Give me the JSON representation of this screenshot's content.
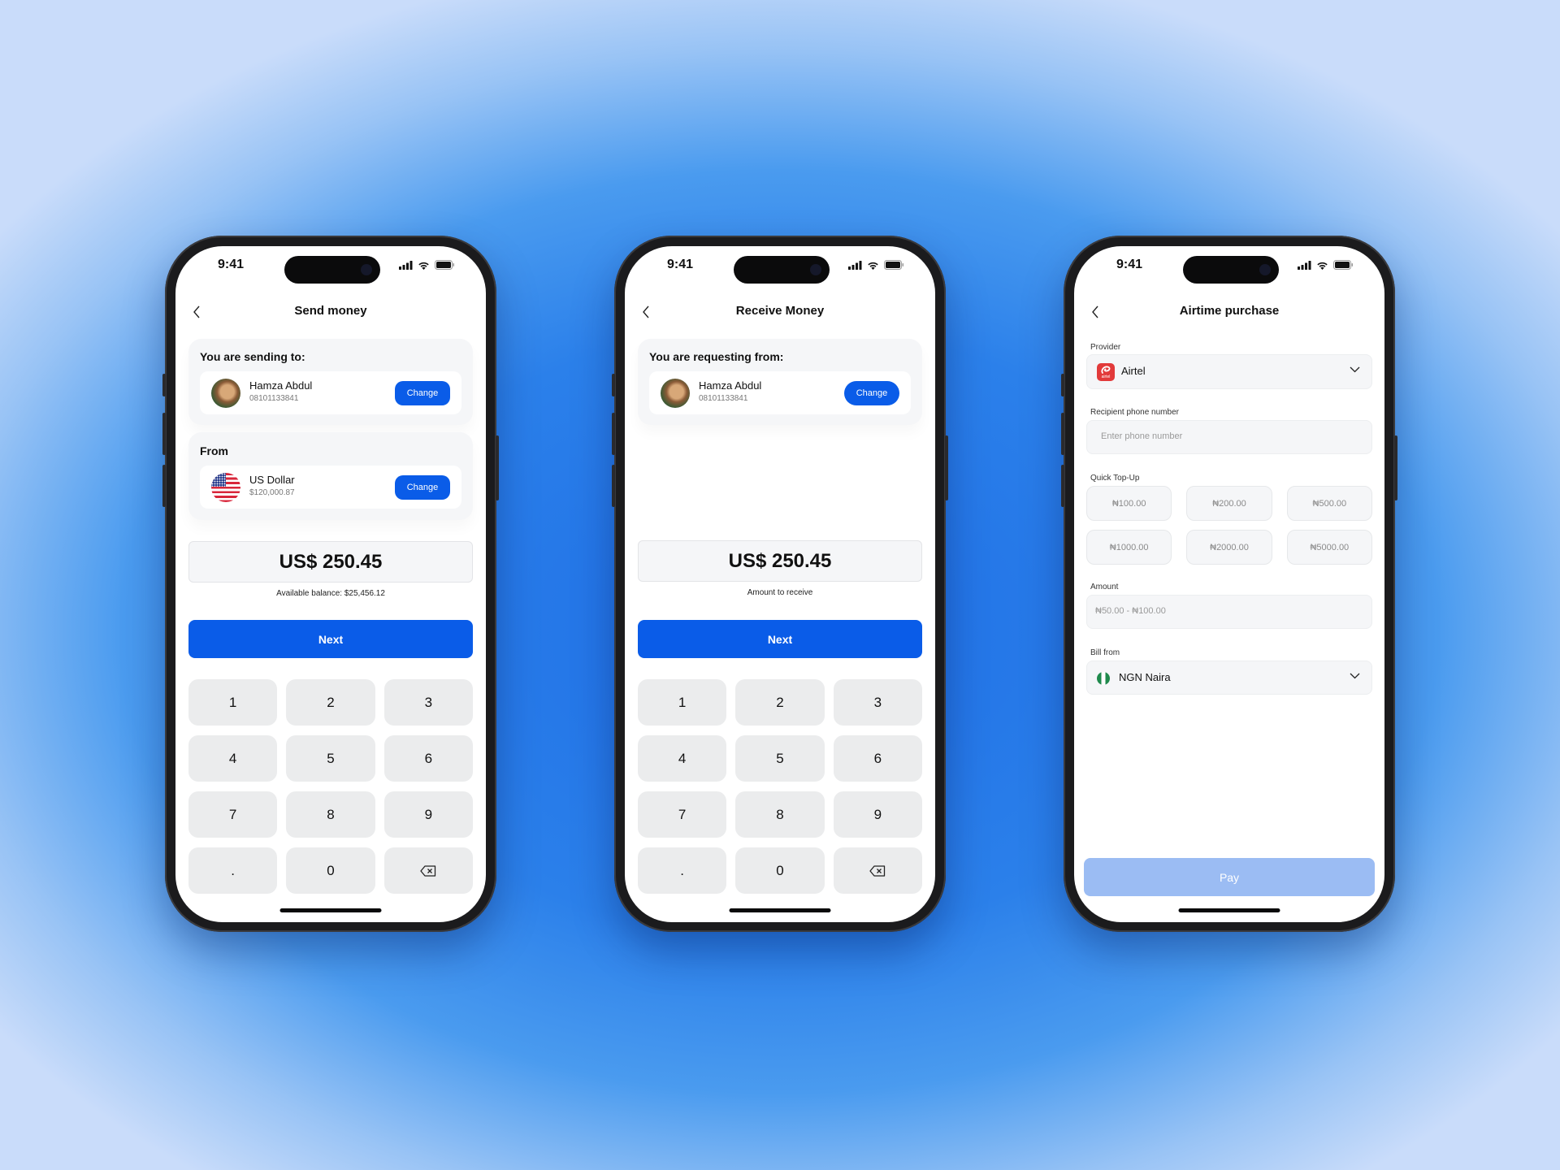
{
  "colors": {
    "primary": "#0a5ce8",
    "primary_disabled": "#9bbcf3",
    "card_bg": "#f5f6f8",
    "key_bg": "#ebeced",
    "airtel_red": "#e23a3a",
    "nigeria_green": "#1f8a4c"
  },
  "status_bar": {
    "time": "9:41",
    "icons": [
      "cellular-signal-icon",
      "wifi-icon",
      "battery-icon"
    ]
  },
  "send_money": {
    "title": "Send money",
    "recipient_section_label": "You are sending to:",
    "recipient": {
      "name": "Hamza Abdul",
      "phone": "08101133841",
      "change_label": "Change"
    },
    "from_section_label": "From",
    "source": {
      "currency": "US Dollar",
      "balance": "$120,000.87",
      "change_label": "Change"
    },
    "amount": "US$ 250.45",
    "available_balance_label": "Available balance:",
    "available_balance_value": "$25,456.12",
    "next_label": "Next"
  },
  "receive_money": {
    "title": "Receive Money",
    "requester_section_label": "You are requesting from:",
    "requester": {
      "name": "Hamza Abdul",
      "phone": "08101133841",
      "change_label": "Change"
    },
    "amount": "US$ 250.45",
    "amount_caption": "Amount to receive",
    "next_label": "Next"
  },
  "keypad": {
    "keys": [
      "1",
      "2",
      "3",
      "4",
      "5",
      "6",
      "7",
      "8",
      "9",
      ".",
      "0"
    ],
    "backspace_icon": "backspace-icon"
  },
  "airtime": {
    "title": "Airtime purchase",
    "provider_label": "Provider",
    "provider_value": "Airtel",
    "provider_logo_text": "airtel",
    "recipient_label": "Recipient phone number",
    "recipient_placeholder": "Enter phone number",
    "quick_topup_label": "Quick Top-Up",
    "quick_topup_options": [
      "₦100.00",
      "₦200.00",
      "₦500.00",
      "₦1000.00",
      "₦2000.00",
      "₦5000.00"
    ],
    "amount_label": "Amount",
    "amount_placeholder": "₦50.00 - ₦100.00",
    "bill_from_label": "Bill from",
    "bill_from_value": "NGN Naira",
    "pay_label": "Pay"
  }
}
